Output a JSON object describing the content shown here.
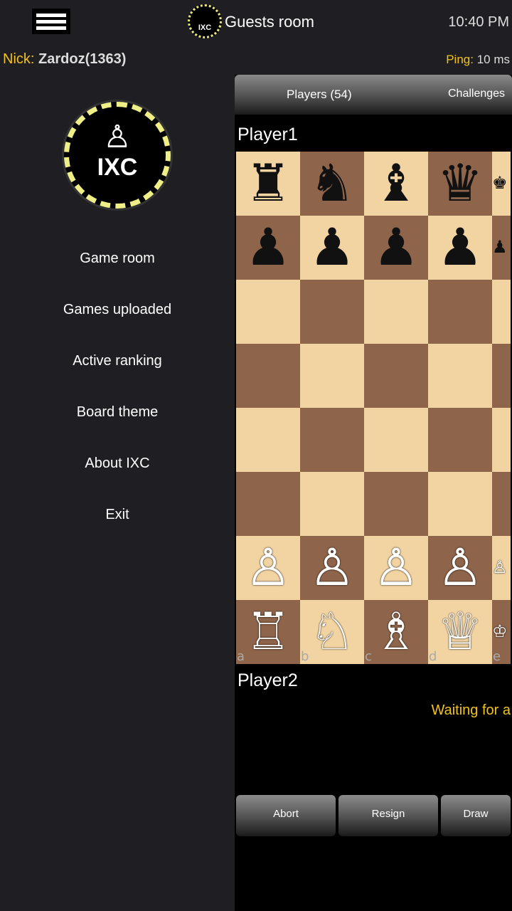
{
  "header": {
    "menu_icon": "hamburger-icon",
    "title": "Guests room",
    "logo_text": "IXC",
    "time": "10:40 PM",
    "nick_label": "Nick:",
    "nick_value": "Zardoz(1363)",
    "ping_label": "Ping:",
    "ping_value": "10 ms"
  },
  "sidebar": {
    "logo_text": "IXC",
    "items": [
      {
        "label": "Game room"
      },
      {
        "label": "Games uploaded"
      },
      {
        "label": "Active ranking"
      },
      {
        "label": "Board theme"
      },
      {
        "label": "About IXC"
      },
      {
        "label": "Exit"
      }
    ]
  },
  "tabs": [
    {
      "label": "Players (54)"
    },
    {
      "label": "Challenges"
    }
  ],
  "game": {
    "player_top": "Player1",
    "player_bottom": "Player2",
    "status": "Waiting for a",
    "files": [
      "a",
      "b",
      "c",
      "d",
      "e"
    ],
    "ranks": [
      "rnbqk",
      "ppppp",
      ".....",
      ".....",
      ".....",
      ".....",
      "PPPPP",
      "RNBQK"
    ],
    "colors": {
      "light": "#f2d3a2",
      "dark": "#8e644a",
      "accent": "#f2c21a"
    }
  },
  "buttons": {
    "abort": "Abort",
    "resign": "Resign",
    "draw": "Draw"
  }
}
